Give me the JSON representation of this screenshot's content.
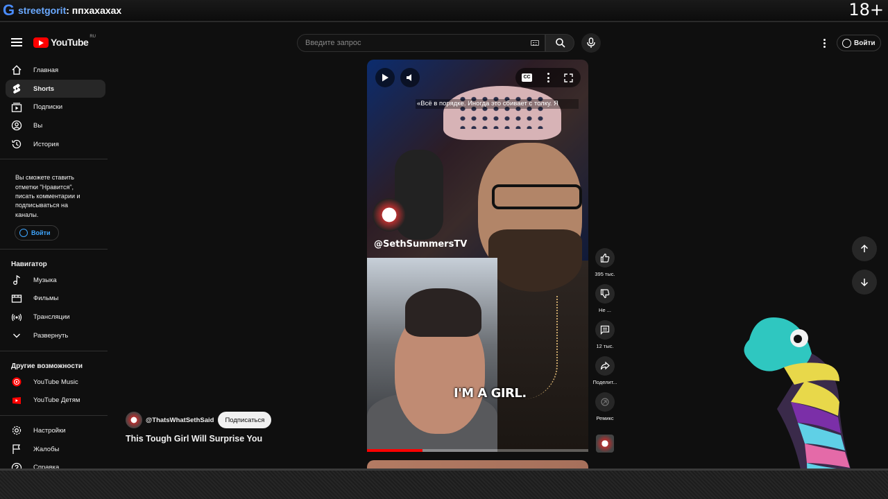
{
  "stream": {
    "channel": "streetgorit",
    "separator": ": ",
    "message": "ппхахахах",
    "age_badge": "18+"
  },
  "header": {
    "logo_text": "YouTube",
    "region": "RU",
    "search_placeholder": "Введите запрос",
    "signin_label": "Войти"
  },
  "sidebar": {
    "main": [
      {
        "label": "Главная",
        "icon": "home-icon"
      },
      {
        "label": "Shorts",
        "icon": "shorts-icon"
      },
      {
        "label": "Подписки",
        "icon": "subscriptions-icon"
      },
      {
        "label": "Вы",
        "icon": "you-icon"
      },
      {
        "label": "История",
        "icon": "history-icon"
      }
    ],
    "signin_prompt": "Вы сможете ставить отметки \"Нравится\", писать комментарии и подписываться на каналы.",
    "signin_label": "Войти",
    "navigator_title": "Навигатор",
    "navigator": [
      {
        "label": "Музыка",
        "icon": "music-icon"
      },
      {
        "label": "Фильмы",
        "icon": "films-icon"
      },
      {
        "label": "Трансляции",
        "icon": "live-icon"
      },
      {
        "label": "Развернуть",
        "icon": "chevron-down-icon"
      }
    ],
    "more_title": "Другие возможности",
    "more": [
      {
        "label": "YouTube Music",
        "icon": "youtube-music-icon"
      },
      {
        "label": "YouTube Детям",
        "icon": "youtube-kids-icon"
      }
    ],
    "bottom": [
      {
        "label": "Настройки",
        "icon": "settings-icon"
      },
      {
        "label": "Жалобы",
        "icon": "flag-icon"
      },
      {
        "label": "Справка",
        "icon": "help-icon"
      }
    ]
  },
  "short": {
    "subtitle": "«Всё в порядке. Иногда это сбивает с толку. Я",
    "channel_watermark": "@SethSummersTV",
    "overlay_caption": "I'M A GIRL.",
    "progress": 0.25,
    "author_handle": "@ThatsWhatSethSaid",
    "subscribe_label": "Подписаться",
    "title": "This Tough Girl Will Surprise You"
  },
  "actions": {
    "like_count": "395 тыс.",
    "dislike_label": "Не ...",
    "comments_count": "12 тыс.",
    "share_label": "Поделит...",
    "remix_label": "Ремикс"
  },
  "colors": {
    "accent": "#ff0000",
    "link": "#3ea6ff",
    "background": "#0f0f0f"
  }
}
